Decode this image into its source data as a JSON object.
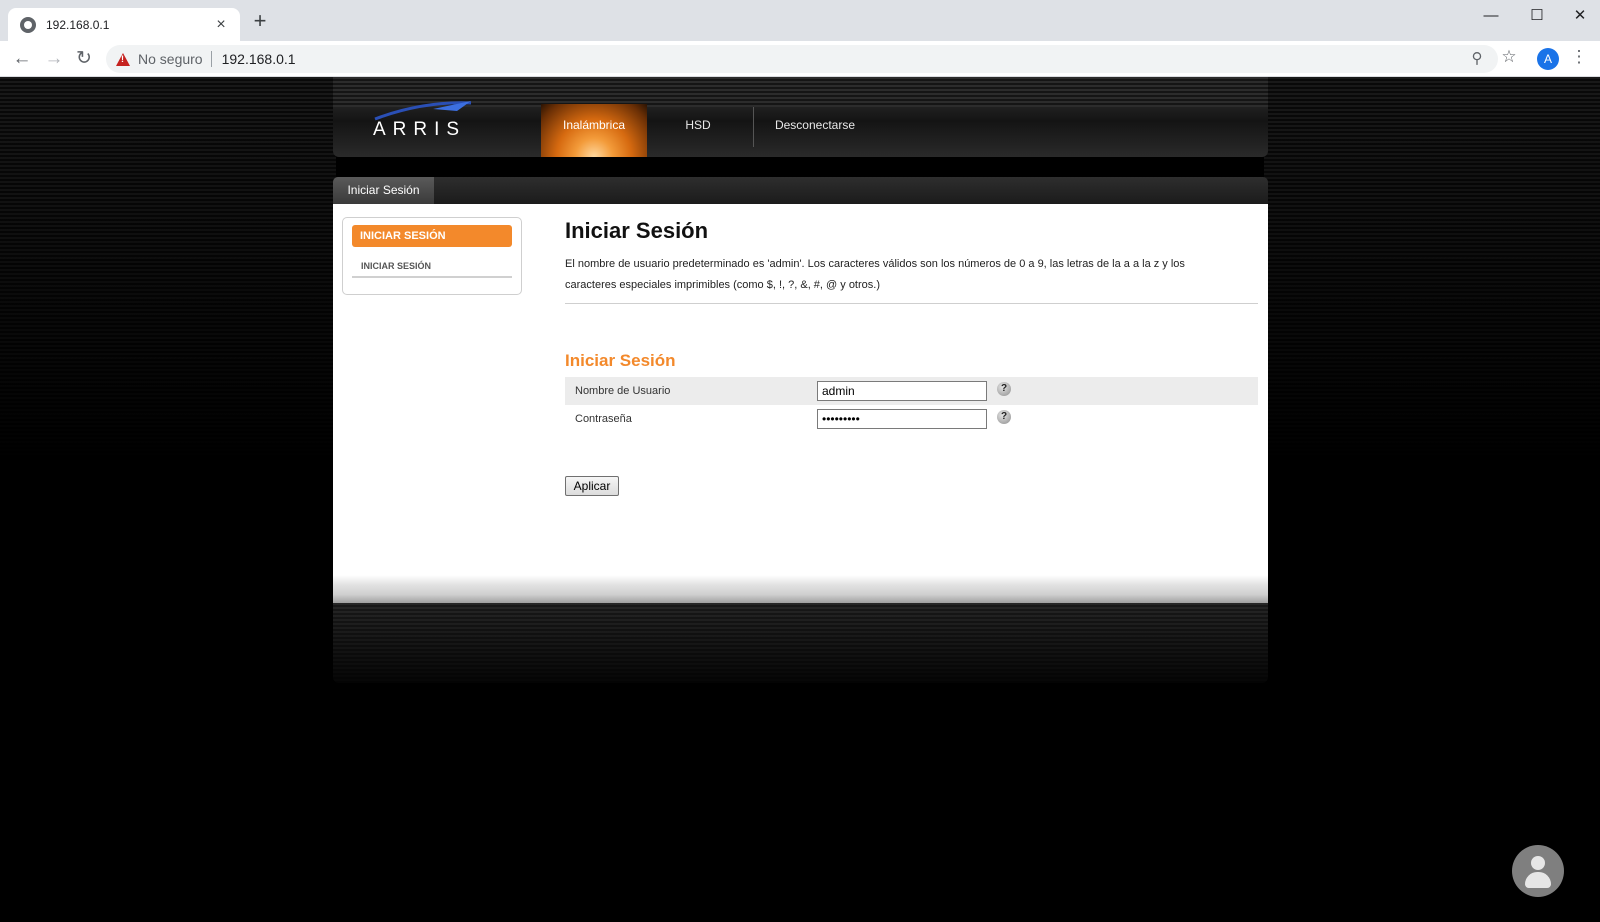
{
  "browser": {
    "tab_title": "192.168.0.1",
    "close_tab_symbol": "×",
    "new_tab_symbol": "+",
    "insecure_label": "No seguro",
    "url": "192.168.0.1",
    "profile_initial": "A",
    "icons": [
      "back-icon",
      "forward-icon",
      "reload-icon",
      "warning-icon",
      "key-icon",
      "star-icon",
      "menu-icon"
    ]
  },
  "router": {
    "logo_text": "ARRIS",
    "nav": {
      "active": "Inalámbrica",
      "hsd": "HSD",
      "logout": "Desconectarse"
    },
    "content_tab": "Iniciar Sesión",
    "sidebar": {
      "active_item": "INICIAR SESIÓN",
      "sub_item": "INICIAR SESIÓN"
    },
    "main": {
      "title": "Iniciar Sesión",
      "description": "El nombre de usuario predeterminado es 'admin'. Los caracteres válidos son los números de 0 a 9, las letras de la a a la z y los caracteres especiales imprimibles (como $, !, ?, &, #, @ y otros.)",
      "section_title": "Iniciar Sesión",
      "username_label": "Nombre de Usuario",
      "username_value": "admin",
      "password_label": "Contraseña",
      "password_value": "•••••••••",
      "help_symbol": "?",
      "apply_label": "Aplicar"
    },
    "accent_color": "#f3892b"
  }
}
